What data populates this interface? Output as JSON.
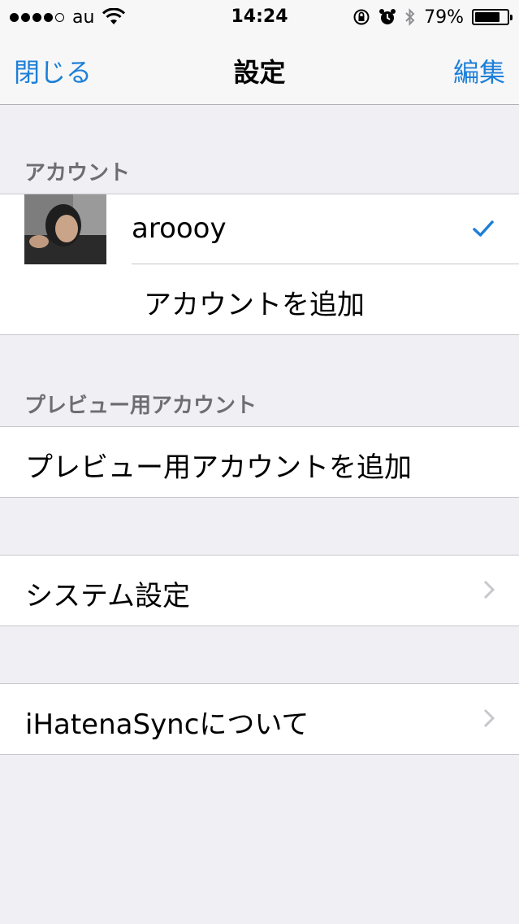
{
  "status_bar": {
    "carrier": "au",
    "time": "14:24",
    "battery_percent": "79%",
    "battery_level": 0.79,
    "signal_bars_filled": 4,
    "signal_bars_total": 5,
    "icons": [
      "signal-dots-icon",
      "wifi-icon",
      "orientation-lock-icon",
      "alarm-icon",
      "bluetooth-icon",
      "battery-icon"
    ]
  },
  "nav": {
    "left_label": "閉じる",
    "title": "設定",
    "right_label": "編集"
  },
  "sections": {
    "account_header": "アカウント",
    "account_name": "aroooy",
    "add_account": "アカウントを追加",
    "preview_header": "プレビュー用アカウント",
    "add_preview_account": "プレビュー用アカウントを追加",
    "system_settings": "システム設定",
    "about": "iHatenaSyncについて"
  },
  "colors": {
    "accent": "#1d7fd8",
    "background": "#efeff4",
    "section_header": "#6d6d72",
    "separator": "#c8c7cc",
    "chevron": "#c7c7cc"
  }
}
